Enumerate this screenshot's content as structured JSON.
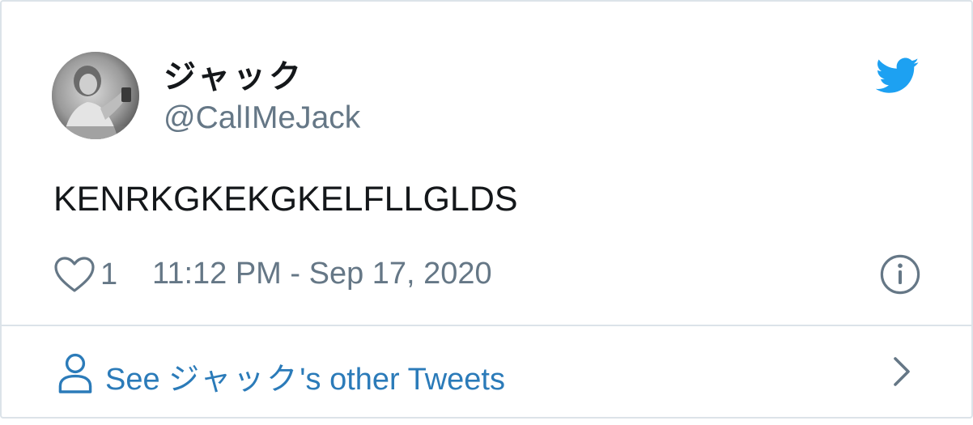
{
  "tweet": {
    "display_name": "ジャック",
    "handle": "@CalIMeJack",
    "text": "KENRKGKEKGKELFLLGLDS",
    "like_count": "1",
    "timestamp": "11:12 PM - Sep 17, 2020"
  },
  "footer": {
    "see_more_prefix": "See ",
    "see_more_name": "ジャック",
    "see_more_suffix": "'s other Tweets"
  },
  "icons": {
    "brand": "twitter-bird-icon",
    "like": "heart-icon",
    "info": "info-icon",
    "profile": "person-icon",
    "more": "chevron-right-icon"
  },
  "colors": {
    "brand_blue": "#1da1f2",
    "link_blue": "#2b7bb9",
    "muted_gray": "#657786",
    "text_dark": "#14171a",
    "border": "#dce3e9"
  }
}
